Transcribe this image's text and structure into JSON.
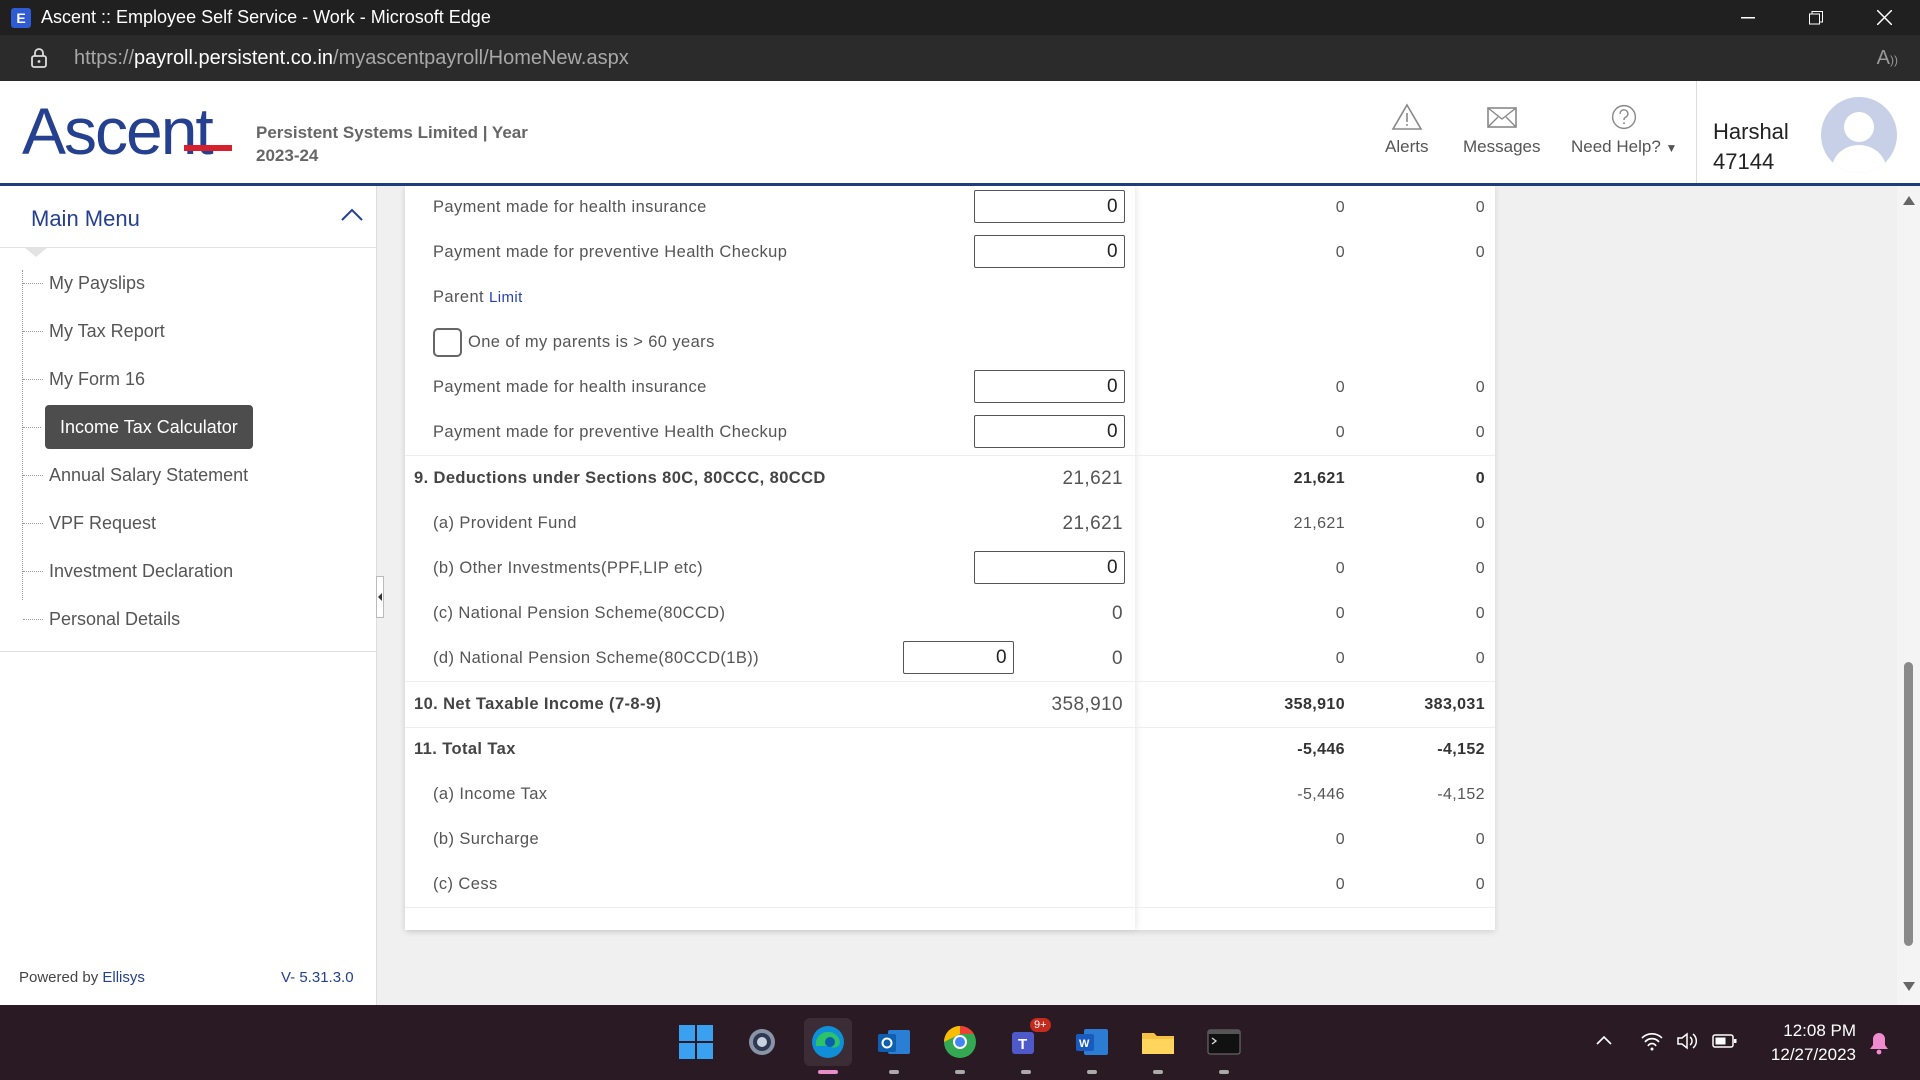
{
  "window": {
    "title": "Ascent :: Employee Self Service - Work - Microsoft Edge",
    "app_icon_letter": "E"
  },
  "address": {
    "url_prefix": "https://",
    "url_host": "payroll.persistent.co.in",
    "url_path": "/myascentpayroll/HomeNew.aspx"
  },
  "header": {
    "logo_text": "Ascent",
    "company_line1": "Persistent Systems Limited | Year",
    "company_line2": "2023-24",
    "alerts_label": "Alerts",
    "messages_label": "Messages",
    "help_label": "Need Help?",
    "user_name": "Harshal",
    "user_id": "47144"
  },
  "sidebar": {
    "title": "Main Menu",
    "items": [
      {
        "label": "My Payslips"
      },
      {
        "label": "My Tax Report"
      },
      {
        "label": "My Form 16"
      },
      {
        "label": "Income Tax Calculator",
        "active": true
      },
      {
        "label": "Annual Salary Statement"
      },
      {
        "label": "VPF Request"
      },
      {
        "label": "Investment Declaration"
      },
      {
        "label": "Personal Details"
      }
    ],
    "powered_prefix": "Powered by",
    "powered_brand": "Ellisys",
    "version": "V- 5.31.3.0"
  },
  "table": {
    "rows": [
      {
        "label": "Payment made for health insurance",
        "input": "0",
        "c2": "0",
        "c3": "0"
      },
      {
        "label": "Payment made for preventive Health Checkup",
        "input": "0",
        "c2": "0",
        "c3": "0"
      },
      {
        "label": "Parent",
        "link": "Limit"
      },
      {
        "label": "One of my parents is > 60 years",
        "checked": false
      },
      {
        "label": "Payment made for health insurance",
        "input": "0",
        "c2": "0",
        "c3": "0"
      },
      {
        "label": "Payment made for preventive Health Checkup",
        "input": "0",
        "c2": "0",
        "c3": "0"
      },
      {
        "label": "9. Deductions under Sections 80C, 80CCC, 80CCD",
        "c1": "21,621",
        "c2": "21,621",
        "c3": "0"
      },
      {
        "label": "(a) Provident Fund",
        "c1": "21,621",
        "c2": "21,621",
        "c3": "0"
      },
      {
        "label": "(b) Other Investments(PPF,LIP etc)",
        "input": "0",
        "c2": "0",
        "c3": "0"
      },
      {
        "label": "(c) National Pension Scheme(80CCD)",
        "c1": "0",
        "c2": "0",
        "c3": "0"
      },
      {
        "label": "(d) National Pension Scheme(80CCD(1B))",
        "input": "0",
        "c1": "0",
        "c2": "0",
        "c3": "0"
      },
      {
        "label": "10. Net Taxable Income (7-8-9)",
        "c1": "358,910",
        "c2": "358,910",
        "c3": "383,031"
      },
      {
        "label": "11. Total Tax",
        "c2": "-5,446",
        "c3": "-4,152"
      },
      {
        "label": "(a) Income Tax",
        "c2": "-5,446",
        "c3": "-4,152"
      },
      {
        "label": "(b) Surcharge",
        "c2": "0",
        "c3": "0"
      },
      {
        "label": "(c) Cess",
        "c2": "0",
        "c3": "0"
      }
    ]
  },
  "taskbar": {
    "time": "12:08 PM",
    "date": "12/27/2023",
    "teams_badge": "9+"
  },
  "colors": {
    "brand_blue": "#25408f",
    "brand_red": "#d6202c",
    "taskbar_bg": "#2a1a24"
  }
}
